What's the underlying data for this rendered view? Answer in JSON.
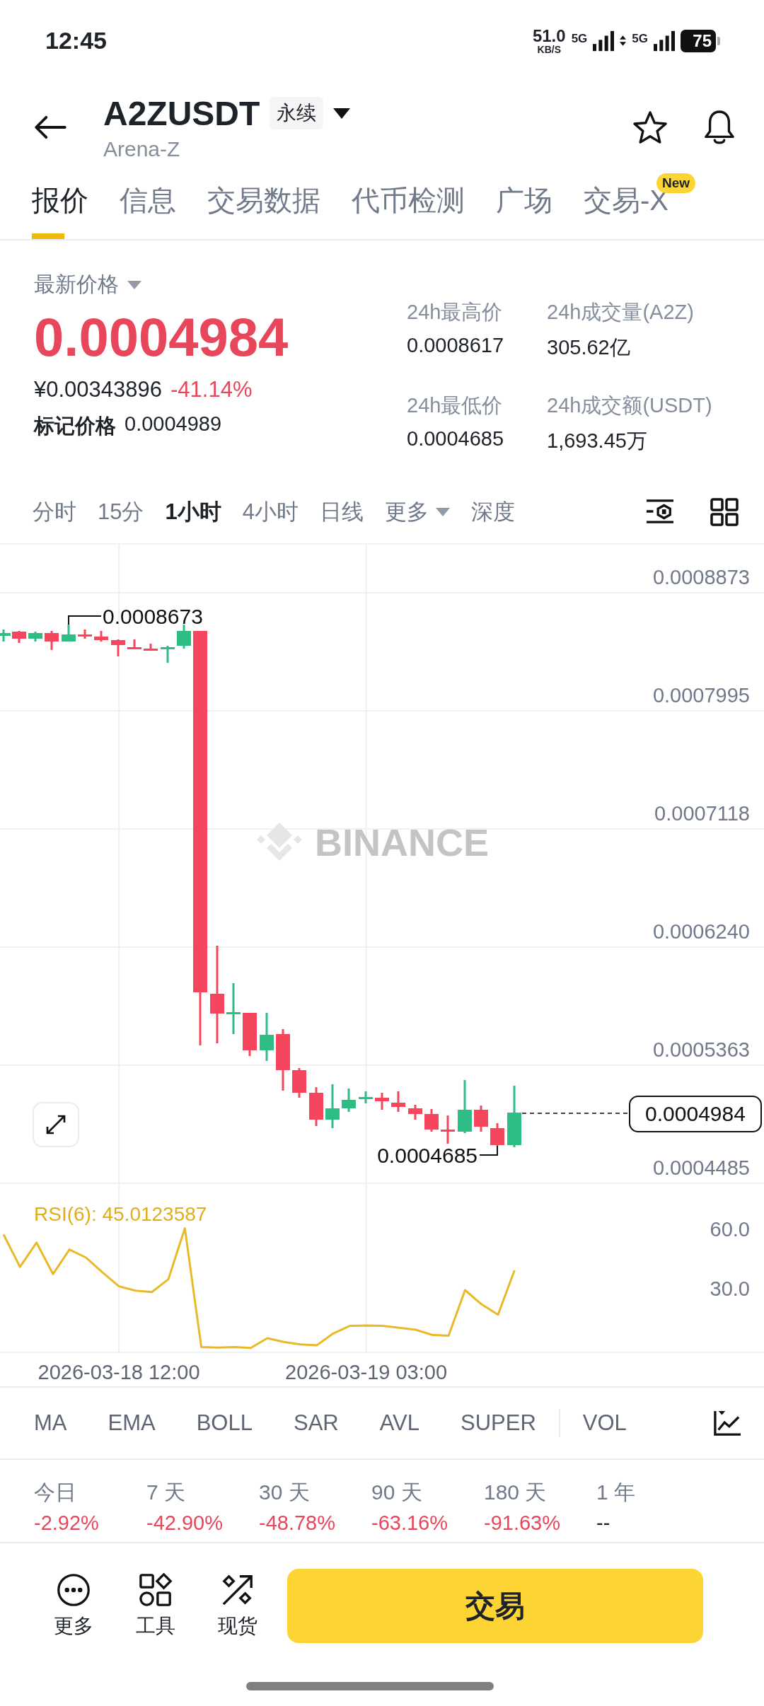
{
  "status_bar": {
    "time": "12:45",
    "net_speed": "51.0",
    "net_unit": "KB/S",
    "network_1": "5G",
    "network_2": "5G",
    "battery": "75"
  },
  "header": {
    "symbol": "A2ZUSDT",
    "contract_tag": "永续",
    "name": "Arena-Z"
  },
  "tabs": [
    {
      "label": "报价",
      "selected": true
    },
    {
      "label": "信息",
      "selected": false
    },
    {
      "label": "交易数据",
      "selected": false
    },
    {
      "label": "代币检测",
      "selected": false
    },
    {
      "label": "广场",
      "selected": false
    },
    {
      "label": "交易-X",
      "selected": false,
      "badge": "New"
    }
  ],
  "price": {
    "label": "最新价格",
    "last": "0.0004984",
    "fiat": "¥0.00343896",
    "change": "-41.14%",
    "mark_label": "标记价格",
    "mark": "0.0004989"
  },
  "stats": [
    {
      "label": "24h最高价",
      "value": "0.0008617"
    },
    {
      "label": "24h成交量(A2Z)",
      "value": "305.62亿"
    },
    {
      "label": "24h最低价",
      "value": "0.0004685"
    },
    {
      "label": "24h成交额(USDT)",
      "value": "1,693.45万"
    }
  ],
  "intervals": [
    {
      "label": "分时",
      "kind": "option",
      "selected": false
    },
    {
      "label": "15分",
      "kind": "option",
      "selected": false
    },
    {
      "label": "1小时",
      "kind": "option",
      "selected": true
    },
    {
      "label": "4小时",
      "kind": "option",
      "selected": false
    },
    {
      "label": "日线",
      "kind": "option",
      "selected": false
    },
    {
      "label": "更多",
      "kind": "dropdown",
      "selected": false
    },
    {
      "label": "深度",
      "kind": "option",
      "selected": false
    }
  ],
  "kline": {
    "watermark": "BINANCE",
    "price_axis": [
      "0.0008873",
      "0.0007995",
      "0.0007118",
      "0.0006240",
      "0.0005363",
      "0.0004485"
    ],
    "high_marker": "0.0008673",
    "low_marker": "0.0004685",
    "last_price": "0.0004984"
  },
  "rsi": {
    "label": "RSI(6): 45.0123587",
    "axis_labels": [
      "60.0",
      "30.0"
    ],
    "time_labels": [
      "2026-03-18 12:00",
      "2026-03-19 03:00"
    ]
  },
  "indicators": [
    "MA",
    "EMA",
    "BOLL",
    "SAR",
    "AVL",
    "SUPER",
    "VOL"
  ],
  "periods": [
    {
      "label": "今日",
      "value": "-2.92%",
      "color": "#e8475b"
    },
    {
      "label": "7 天",
      "value": "-42.90%",
      "color": "#e8475b"
    },
    {
      "label": "30 天",
      "value": "-48.78%",
      "color": "#e8475b"
    },
    {
      "label": "90 天",
      "value": "-63.16%",
      "color": "#e8475b"
    },
    {
      "label": "180 天",
      "value": "-91.63%",
      "color": "#e8475b"
    },
    {
      "label": "1 年",
      "value": "--",
      "color": "#1e2329"
    }
  ],
  "bottom_bar": {
    "actions": [
      {
        "kind": "more",
        "label": "更多"
      },
      {
        "kind": "tools",
        "label": "工具"
      },
      {
        "kind": "spot",
        "label": "现货"
      }
    ],
    "trade_button": "交易"
  }
}
